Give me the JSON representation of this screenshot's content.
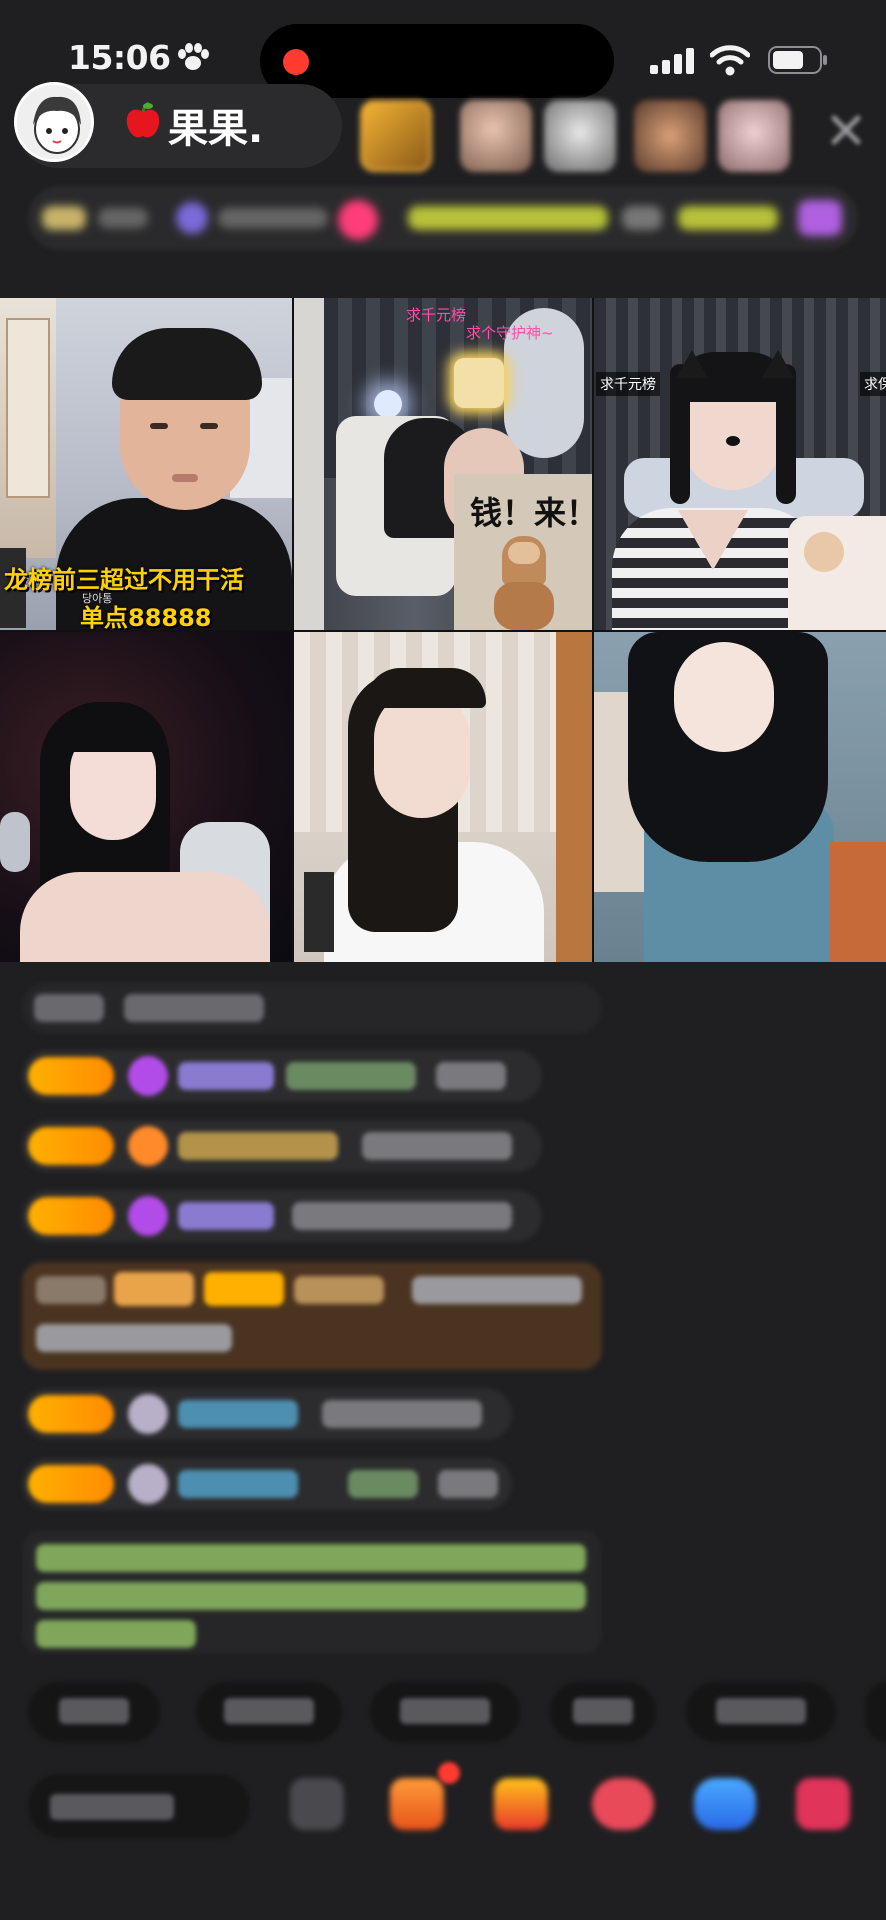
{
  "status_bar": {
    "time": "15:06"
  },
  "host": {
    "name": "果果."
  },
  "grid": {
    "cell1": {
      "caption_line1": "龙榜前三超过不用干活",
      "caption_line2": "单点88888",
      "small_caption": "당아통"
    },
    "cell2": {
      "caption_top1": "求千元榜",
      "caption_top2": "求个守护神~",
      "meme_text": "钱！来！"
    },
    "cell3": {
      "tag_left": "求千元榜",
      "tag_right": "求保"
    }
  },
  "colors": {
    "accent_yellow": "#ffd200",
    "badge_orange": "#ff9d00",
    "background": "#1f1f21",
    "chat_green": "#8fd14f",
    "record_red": "#ff3b30"
  },
  "icons": [
    "paw-icon",
    "signal-icon",
    "wifi-icon",
    "battery-icon",
    "apple-icon",
    "close-icon",
    "gift-icon"
  ]
}
